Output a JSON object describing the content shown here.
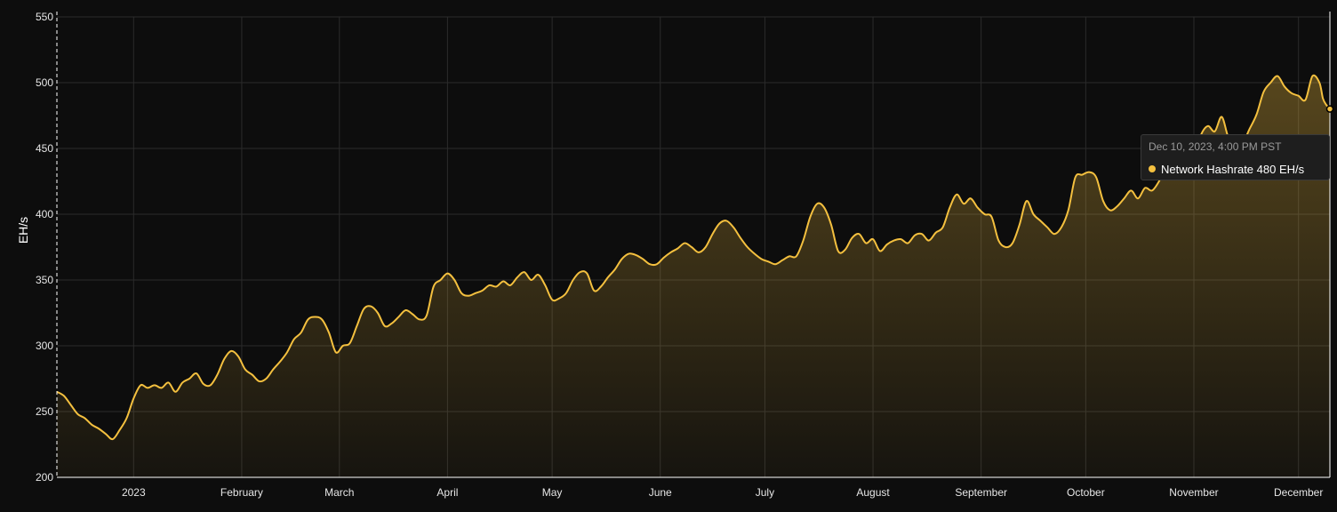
{
  "colors": {
    "background": "#0d0d0d",
    "series": "#f4c03f",
    "grid": "#2b2b2b",
    "axis": "#ffffff"
  },
  "tooltip": {
    "time": "Dec 10, 2023, 4:00 PM PST",
    "series_name": "Network Hashrate",
    "value": "480 EH/s",
    "icon": "dot-icon"
  },
  "chart_data": {
    "type": "area",
    "title": "",
    "xlabel": "",
    "ylabel": "EH/s",
    "ylim": [
      200,
      550
    ],
    "grid": true,
    "yticks": [
      200,
      250,
      300,
      350,
      400,
      450,
      500,
      550
    ],
    "xlim": [
      "2022-12-10",
      "2023-12-10"
    ],
    "xticks": [
      {
        "label": "2023",
        "date": "2023-01-01"
      },
      {
        "label": "February",
        "date": "2023-02-01"
      },
      {
        "label": "March",
        "date": "2023-03-01"
      },
      {
        "label": "April",
        "date": "2023-04-01"
      },
      {
        "label": "May",
        "date": "2023-05-01"
      },
      {
        "label": "June",
        "date": "2023-06-01"
      },
      {
        "label": "July",
        "date": "2023-07-01"
      },
      {
        "label": "August",
        "date": "2023-08-01"
      },
      {
        "label": "September",
        "date": "2023-09-01"
      },
      {
        "label": "October",
        "date": "2023-10-01"
      },
      {
        "label": "November",
        "date": "2023-11-01"
      },
      {
        "label": "December",
        "date": "2023-12-01"
      }
    ],
    "series": [
      {
        "name": "Network Hashrate",
        "points": [
          [
            "2022-12-10",
            265
          ],
          [
            "2022-12-12",
            262
          ],
          [
            "2022-12-14",
            255
          ],
          [
            "2022-12-16",
            248
          ],
          [
            "2022-12-18",
            245
          ],
          [
            "2022-12-20",
            240
          ],
          [
            "2022-12-22",
            237
          ],
          [
            "2022-12-24",
            233
          ],
          [
            "2022-12-26",
            229
          ],
          [
            "2022-12-28",
            236
          ],
          [
            "2022-12-30",
            245
          ],
          [
            "2023-01-01",
            260
          ],
          [
            "2023-01-03",
            270
          ],
          [
            "2023-01-05",
            268
          ],
          [
            "2023-01-07",
            270
          ],
          [
            "2023-01-09",
            268
          ],
          [
            "2023-01-11",
            272
          ],
          [
            "2023-01-13",
            265
          ],
          [
            "2023-01-15",
            272
          ],
          [
            "2023-01-17",
            275
          ],
          [
            "2023-01-19",
            279
          ],
          [
            "2023-01-21",
            271
          ],
          [
            "2023-01-23",
            270
          ],
          [
            "2023-01-25",
            278
          ],
          [
            "2023-01-27",
            290
          ],
          [
            "2023-01-29",
            296
          ],
          [
            "2023-01-31",
            292
          ],
          [
            "2023-02-02",
            282
          ],
          [
            "2023-02-04",
            278
          ],
          [
            "2023-02-06",
            273
          ],
          [
            "2023-02-08",
            275
          ],
          [
            "2023-02-10",
            282
          ],
          [
            "2023-02-12",
            288
          ],
          [
            "2023-02-14",
            295
          ],
          [
            "2023-02-16",
            305
          ],
          [
            "2023-02-18",
            310
          ],
          [
            "2023-02-20",
            320
          ],
          [
            "2023-02-22",
            322
          ],
          [
            "2023-02-24",
            320
          ],
          [
            "2023-02-26",
            310
          ],
          [
            "2023-02-28",
            295
          ],
          [
            "2023-03-02",
            300
          ],
          [
            "2023-03-04",
            302
          ],
          [
            "2023-03-06",
            315
          ],
          [
            "2023-03-08",
            328
          ],
          [
            "2023-03-10",
            330
          ],
          [
            "2023-03-12",
            325
          ],
          [
            "2023-03-14",
            315
          ],
          [
            "2023-03-16",
            317
          ],
          [
            "2023-03-18",
            322
          ],
          [
            "2023-03-20",
            327
          ],
          [
            "2023-03-22",
            324
          ],
          [
            "2023-03-24",
            320
          ],
          [
            "2023-03-26",
            323
          ],
          [
            "2023-03-28",
            345
          ],
          [
            "2023-03-30",
            350
          ],
          [
            "2023-04-01",
            355
          ],
          [
            "2023-04-03",
            350
          ],
          [
            "2023-04-05",
            340
          ],
          [
            "2023-04-07",
            338
          ],
          [
            "2023-04-09",
            340
          ],
          [
            "2023-04-11",
            342
          ],
          [
            "2023-04-13",
            346
          ],
          [
            "2023-04-15",
            345
          ],
          [
            "2023-04-17",
            349
          ],
          [
            "2023-04-19",
            346
          ],
          [
            "2023-04-21",
            352
          ],
          [
            "2023-04-23",
            356
          ],
          [
            "2023-04-25",
            350
          ],
          [
            "2023-04-27",
            354
          ],
          [
            "2023-04-29",
            346
          ],
          [
            "2023-05-01",
            335
          ],
          [
            "2023-05-03",
            336
          ],
          [
            "2023-05-05",
            340
          ],
          [
            "2023-05-07",
            350
          ],
          [
            "2023-05-09",
            356
          ],
          [
            "2023-05-11",
            355
          ],
          [
            "2023-05-13",
            342
          ],
          [
            "2023-05-15",
            345
          ],
          [
            "2023-05-17",
            352
          ],
          [
            "2023-05-19",
            358
          ],
          [
            "2023-05-21",
            366
          ],
          [
            "2023-05-23",
            370
          ],
          [
            "2023-05-25",
            369
          ],
          [
            "2023-05-27",
            366
          ],
          [
            "2023-05-29",
            362
          ],
          [
            "2023-05-31",
            362
          ],
          [
            "2023-06-02",
            367
          ],
          [
            "2023-06-04",
            371
          ],
          [
            "2023-06-06",
            374
          ],
          [
            "2023-06-08",
            378
          ],
          [
            "2023-06-10",
            375
          ],
          [
            "2023-06-12",
            371
          ],
          [
            "2023-06-14",
            375
          ],
          [
            "2023-06-16",
            385
          ],
          [
            "2023-06-18",
            393
          ],
          [
            "2023-06-20",
            395
          ],
          [
            "2023-06-22",
            390
          ],
          [
            "2023-06-24",
            382
          ],
          [
            "2023-06-26",
            375
          ],
          [
            "2023-06-28",
            370
          ],
          [
            "2023-06-30",
            366
          ],
          [
            "2023-07-02",
            364
          ],
          [
            "2023-07-04",
            362
          ],
          [
            "2023-07-06",
            365
          ],
          [
            "2023-07-08",
            368
          ],
          [
            "2023-07-10",
            368
          ],
          [
            "2023-07-12",
            380
          ],
          [
            "2023-07-14",
            398
          ],
          [
            "2023-07-16",
            408
          ],
          [
            "2023-07-18",
            405
          ],
          [
            "2023-07-20",
            392
          ],
          [
            "2023-07-22",
            372
          ],
          [
            "2023-07-24",
            373
          ],
          [
            "2023-07-26",
            382
          ],
          [
            "2023-07-28",
            385
          ],
          [
            "2023-07-30",
            378
          ],
          [
            "2023-08-01",
            381
          ],
          [
            "2023-08-03",
            372
          ],
          [
            "2023-08-05",
            377
          ],
          [
            "2023-08-07",
            380
          ],
          [
            "2023-08-09",
            381
          ],
          [
            "2023-08-11",
            378
          ],
          [
            "2023-08-13",
            384
          ],
          [
            "2023-08-15",
            385
          ],
          [
            "2023-08-17",
            380
          ],
          [
            "2023-08-19",
            386
          ],
          [
            "2023-08-21",
            390
          ],
          [
            "2023-08-23",
            405
          ],
          [
            "2023-08-25",
            415
          ],
          [
            "2023-08-27",
            408
          ],
          [
            "2023-08-29",
            412
          ],
          [
            "2023-08-31",
            405
          ],
          [
            "2023-09-02",
            400
          ],
          [
            "2023-09-04",
            398
          ],
          [
            "2023-09-06",
            380
          ],
          [
            "2023-09-08",
            375
          ],
          [
            "2023-09-10",
            378
          ],
          [
            "2023-09-12",
            392
          ],
          [
            "2023-09-14",
            410
          ],
          [
            "2023-09-16",
            400
          ],
          [
            "2023-09-18",
            395
          ],
          [
            "2023-09-20",
            390
          ],
          [
            "2023-09-22",
            385
          ],
          [
            "2023-09-24",
            390
          ],
          [
            "2023-09-26",
            403
          ],
          [
            "2023-09-28",
            428
          ],
          [
            "2023-09-30",
            430
          ],
          [
            "2023-10-02",
            432
          ],
          [
            "2023-10-04",
            428
          ],
          [
            "2023-10-06",
            410
          ],
          [
            "2023-10-08",
            403
          ],
          [
            "2023-10-10",
            406
          ],
          [
            "2023-10-12",
            412
          ],
          [
            "2023-10-14",
            418
          ],
          [
            "2023-10-16",
            412
          ],
          [
            "2023-10-18",
            420
          ],
          [
            "2023-10-20",
            418
          ],
          [
            "2023-10-22",
            425
          ],
          [
            "2023-10-24",
            436
          ],
          [
            "2023-10-26",
            443
          ],
          [
            "2023-10-28",
            455
          ],
          [
            "2023-10-30",
            449
          ],
          [
            "2023-11-01",
            442
          ],
          [
            "2023-11-03",
            460
          ],
          [
            "2023-11-05",
            467
          ],
          [
            "2023-11-07",
            463
          ],
          [
            "2023-11-09",
            474
          ],
          [
            "2023-11-11",
            458
          ],
          [
            "2023-11-13",
            460
          ],
          [
            "2023-11-15",
            455
          ],
          [
            "2023-11-17",
            465
          ],
          [
            "2023-11-19",
            476
          ],
          [
            "2023-11-21",
            493
          ],
          [
            "2023-11-23",
            500
          ],
          [
            "2023-11-25",
            505
          ],
          [
            "2023-11-27",
            497
          ],
          [
            "2023-11-29",
            492
          ],
          [
            "2023-12-01",
            490
          ],
          [
            "2023-12-03",
            487
          ],
          [
            "2023-12-05",
            505
          ],
          [
            "2023-12-07",
            500
          ],
          [
            "2023-12-08",
            488
          ],
          [
            "2023-12-09",
            483
          ],
          [
            "2023-12-10",
            480
          ]
        ]
      }
    ]
  }
}
